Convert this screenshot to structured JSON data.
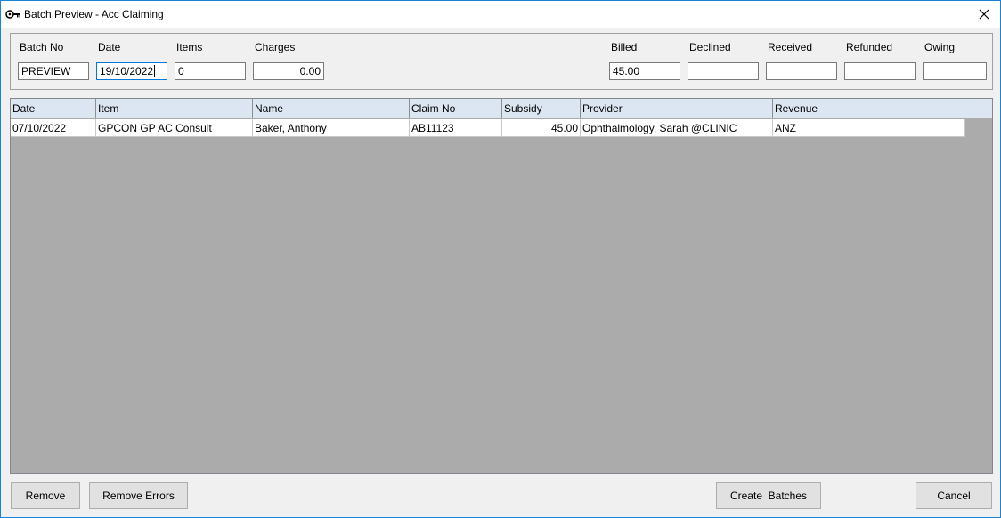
{
  "window": {
    "title": "Batch Preview - Acc Claiming",
    "app_icon": "key-icon",
    "close_icon": "close-icon"
  },
  "header": {
    "batch_no": {
      "label": "Batch No",
      "value": "PREVIEW"
    },
    "date": {
      "label": "Date",
      "value": "19/10/2022"
    },
    "items": {
      "label": "Items",
      "value": "0"
    },
    "charges": {
      "label": "Charges",
      "value": "0.00"
    },
    "billed": {
      "label": "Billed",
      "value": "45.00"
    },
    "declined": {
      "label": "Declined",
      "value": ""
    },
    "received": {
      "label": "Received",
      "value": ""
    },
    "refunded": {
      "label": "Refunded",
      "value": ""
    },
    "owing": {
      "label": "Owing",
      "value": ""
    }
  },
  "grid": {
    "columns": [
      "Date",
      "Item",
      "Name",
      "Claim No",
      "Subsidy",
      "Provider",
      "Revenue"
    ],
    "rows": [
      [
        "07/10/2022",
        "GPCON GP AC Consult",
        "Baker, Anthony",
        "AB11123",
        "45.00",
        "Ophthalmology, Sarah @CLINIC",
        "ANZ"
      ]
    ]
  },
  "buttons": {
    "remove": "Remove",
    "remove_errors": "Remove Errors",
    "create_batches": "Create  Batches",
    "cancel": "Cancel"
  },
  "colors": {
    "grid_background": "#ababab",
    "header_background": "#dbe6f2",
    "window_border": "#1883d7"
  }
}
